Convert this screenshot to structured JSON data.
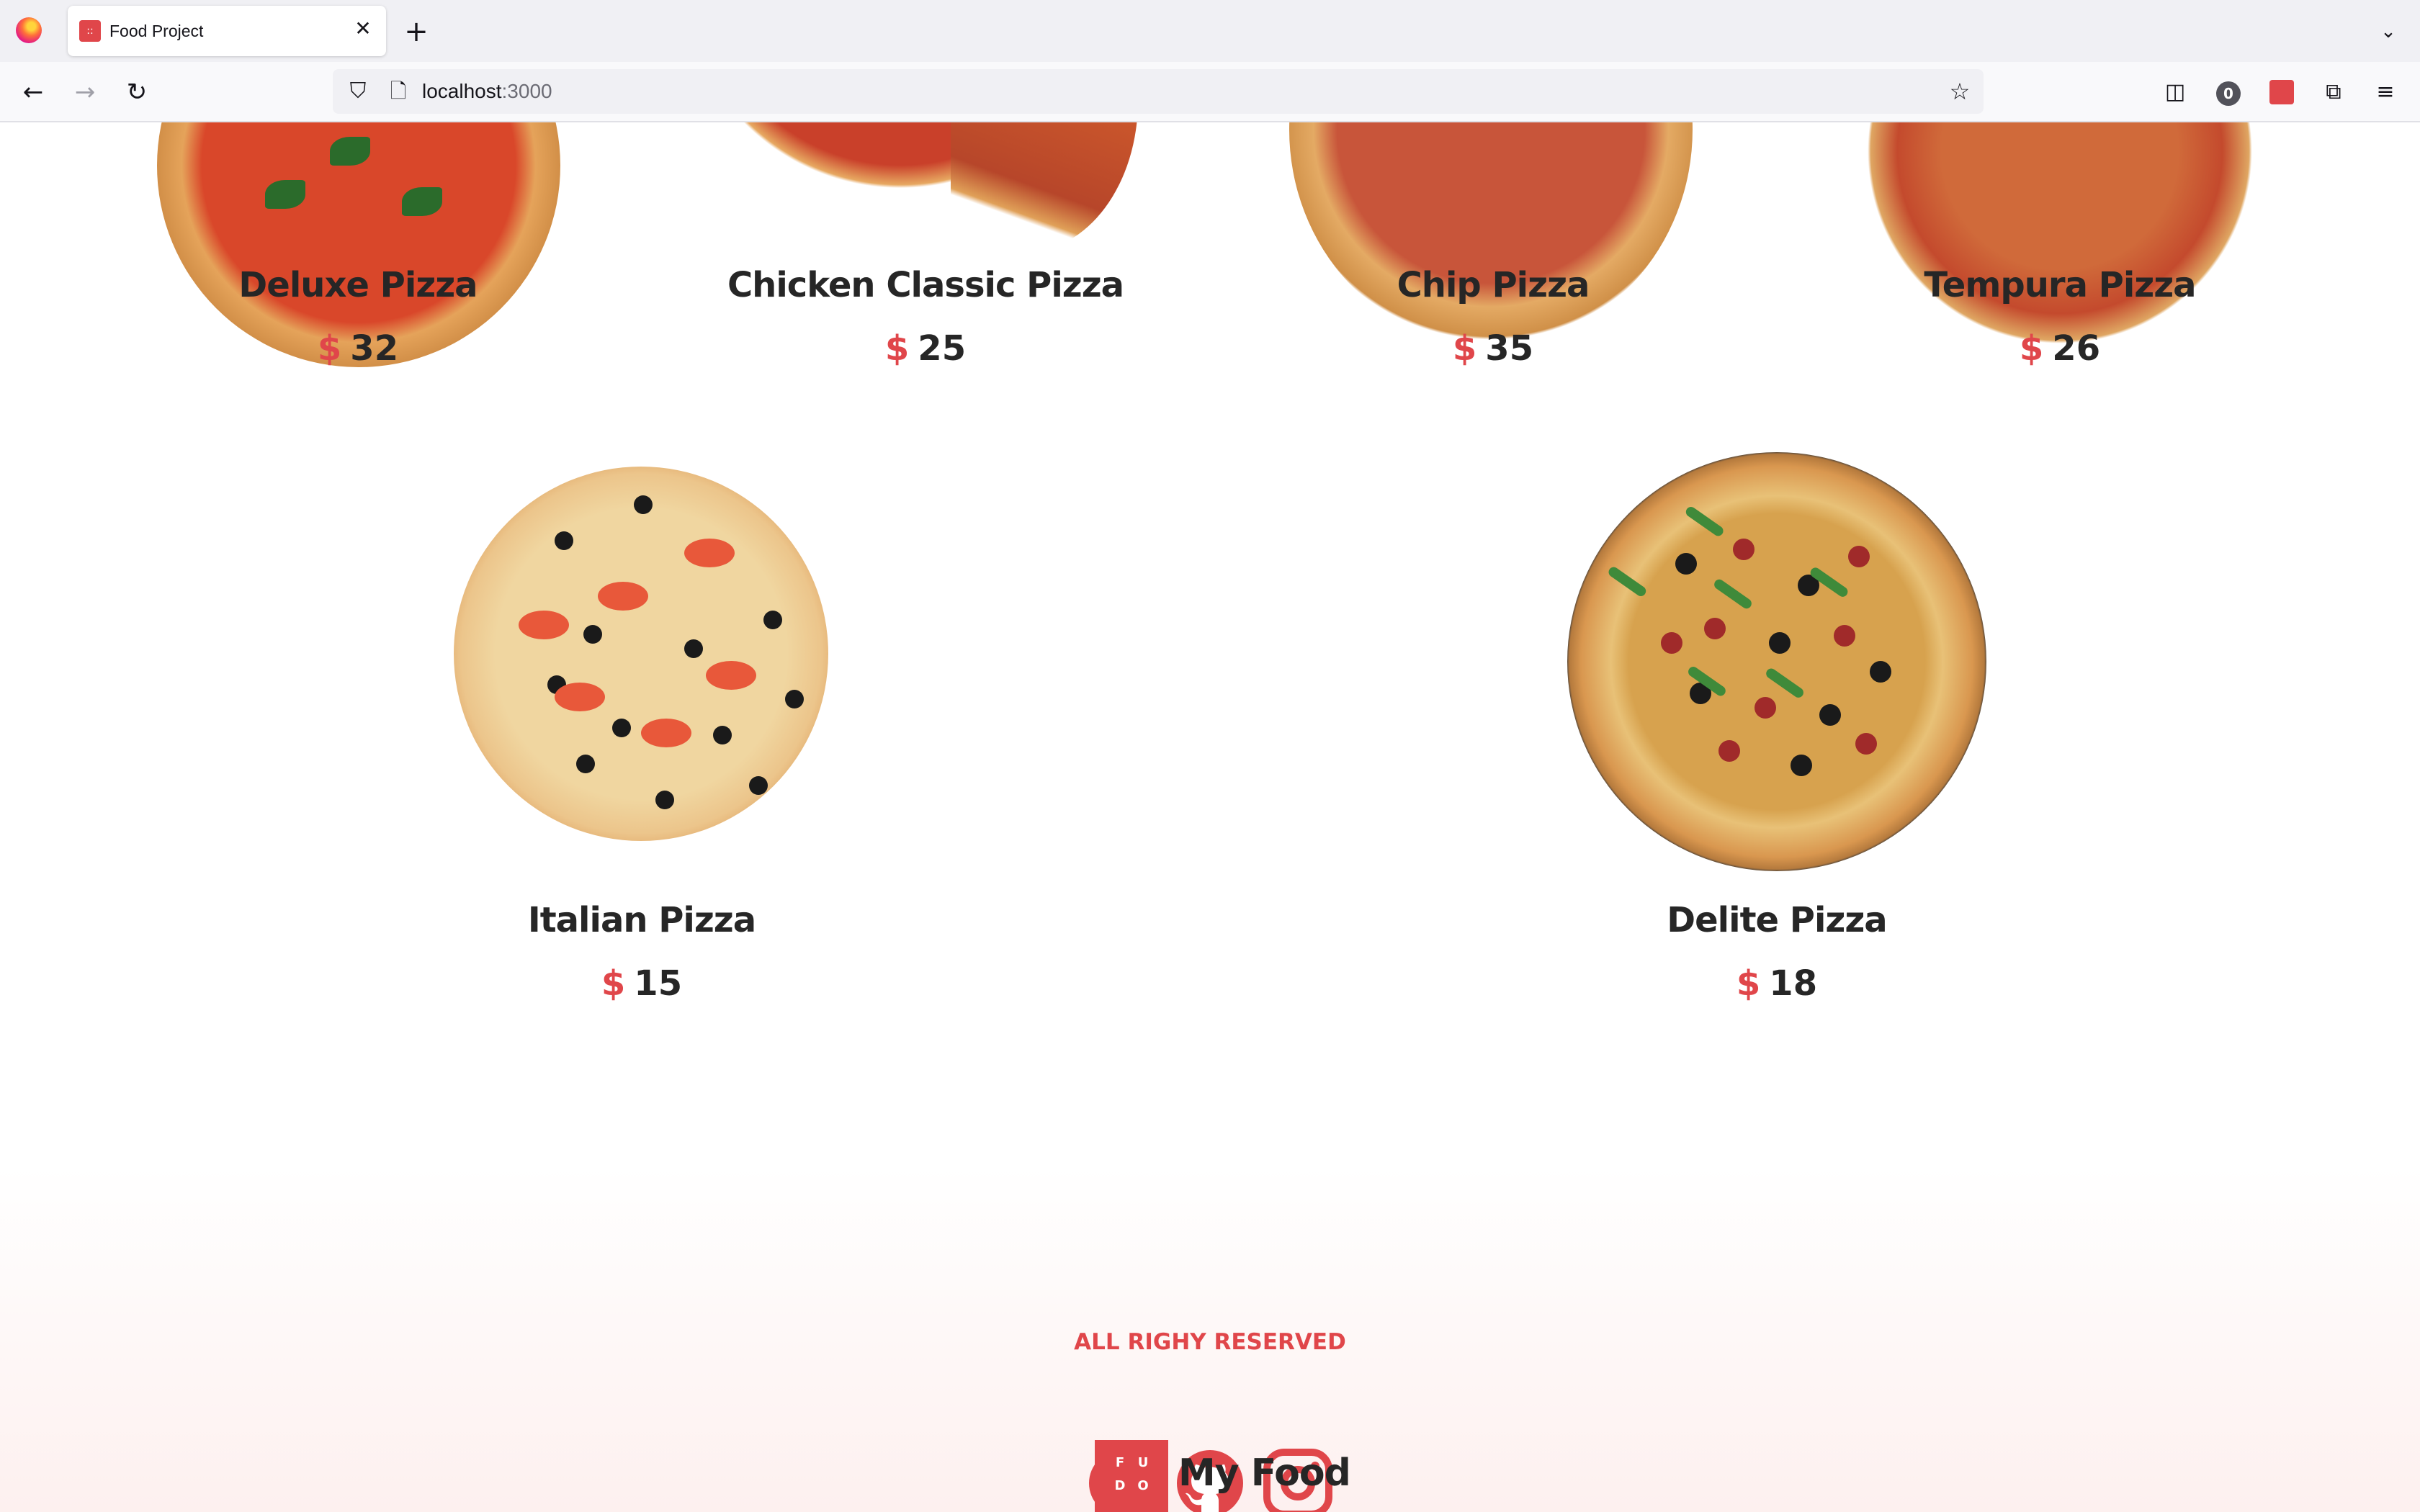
{
  "browser": {
    "tab_title": "Food Project",
    "tab_close": "✕",
    "new_tab": "+",
    "url_host": "localhost",
    "url_port": ":3000",
    "badge_count": "0"
  },
  "pizzas": [
    {
      "name": "Deluxe Pizza",
      "currency": "$",
      "price": "32"
    },
    {
      "name": "Chicken Classic Pizza",
      "currency": "$",
      "price": "25"
    },
    {
      "name": "Chip Pizza",
      "currency": "$",
      "price": "35"
    },
    {
      "name": "Tempura Pizza",
      "currency": "$",
      "price": "26"
    },
    {
      "name": "Italian Pizza",
      "currency": "$",
      "price": "15"
    },
    {
      "name": "Delite Pizza",
      "currency": "$",
      "price": "18"
    }
  ],
  "footer": {
    "text": "ALL RIGHY RESERVED",
    "social_icons": [
      "facebook-icon",
      "github-icon",
      "instagram-icon"
    ],
    "brand_logo_letters": [
      "F",
      "U",
      "D",
      "O"
    ],
    "brand_name": "My Food"
  },
  "colors": {
    "accent": "#e0464a",
    "text": "#262626"
  }
}
